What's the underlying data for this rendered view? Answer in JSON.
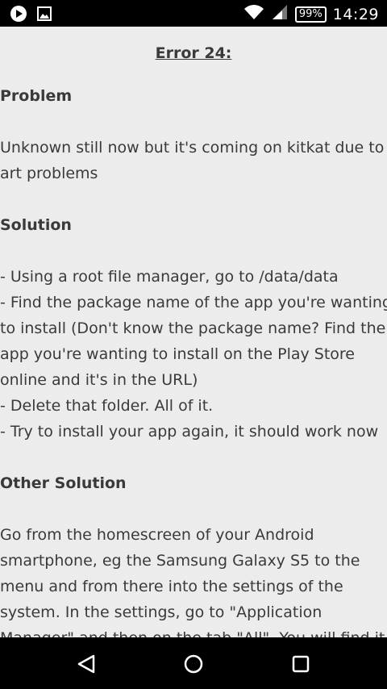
{
  "status": {
    "battery": "99%",
    "time": "14:29"
  },
  "article": {
    "title": "Error 24:",
    "problem_heading": "Problem",
    "problem_text_lines": [
      "Unknown still now but it's coming on kitkat due to",
      "art problems"
    ],
    "solution_heading": "Solution",
    "solution_lines": [
      "- Using a root file manager, go to /data/data",
      "- Find the package name of the app you're wanting",
      "to install (Don't know the package name? Find the",
      "app you're wanting to install on the Play Store",
      "online and it's in the URL)",
      "- Delete that folder. All of it.",
      "- Try to install your app again, it should work now"
    ],
    "other_heading": "Other Solution",
    "other_lines": [
      "Go from the homescreen of your Android",
      "smartphone, eg the Samsung Galaxy S5 to the",
      "menu and from there into the settings of the",
      "system. In the settings, go to \"Application",
      "Manager\" and then on the tab \"All\". You will find it"
    ]
  },
  "nav": {
    "back": "back-icon",
    "home": "home-icon",
    "recents": "recents-icon"
  }
}
